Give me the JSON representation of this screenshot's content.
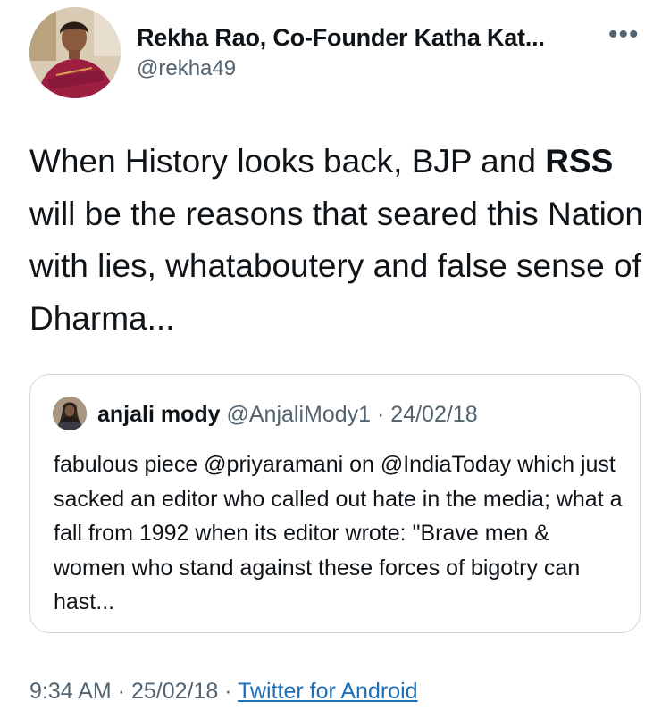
{
  "author": {
    "display_name": "Rekha Rao, Co-Founder Katha Kat...",
    "handle": "@rekha49",
    "avatar_icon": "profile-photo"
  },
  "more_icon": "more-horizontal-icon",
  "more_label": "•••",
  "tweet": {
    "text_part1": "When History looks back, BJP and ",
    "text_bold": "RSS",
    "text_part2": " will be the reasons that seared this Nation with lies, whataboutery and false sense of Dharma..."
  },
  "quote": {
    "name": "anjali mody",
    "handle": "@AnjaliMody1",
    "separator": "·",
    "date": "24/02/18",
    "text": "fabulous piece @priyaramani on @IndiaToday which just sacked an editor who called out hate in the media; what a fall from 1992 when its editor wrote: \"Brave men & women who stand against these forces of bigotry can hast..."
  },
  "footer": {
    "time": "9:34 AM",
    "separator": "·",
    "date": "25/02/18",
    "source": "Twitter for Android"
  },
  "colors": {
    "text": "#0f1419",
    "secondary": "#536471",
    "border": "#cfd9de",
    "link": "#1d6fb8"
  }
}
